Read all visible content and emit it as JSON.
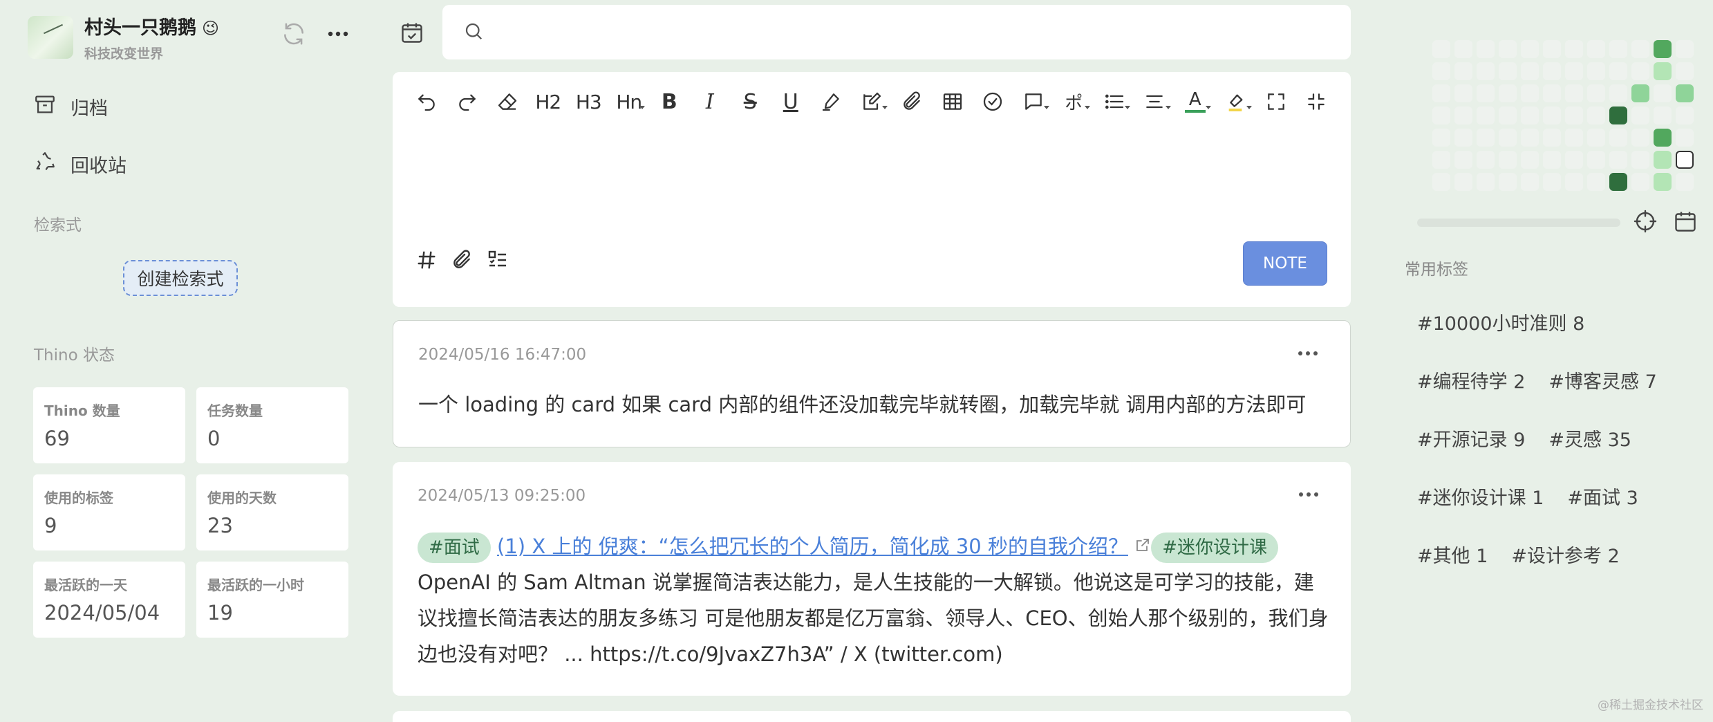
{
  "profile": {
    "name": "村头一只鹅鹅",
    "emoji": "😉",
    "subtitle": "科技改变世界"
  },
  "nav": {
    "archive": "归档",
    "recycle": "回收站"
  },
  "queries": {
    "title": "检索式",
    "create": "创建检索式"
  },
  "stats": {
    "title": "Thino 状态",
    "items": [
      {
        "label": "Thino 数量",
        "value": "69"
      },
      {
        "label": "任务数量",
        "value": "0"
      },
      {
        "label": "使用的标签",
        "value": "9"
      },
      {
        "label": "使用的天数",
        "value": "23"
      },
      {
        "label": "最活跃的一天",
        "value": "2024/05/04"
      },
      {
        "label": "最活跃的一小时",
        "value": "19"
      }
    ]
  },
  "search": {
    "placeholder": ""
  },
  "editor": {
    "toolbar": [
      "undo-icon",
      "redo-icon",
      "eraser-icon",
      "H2",
      "H3",
      "Hn",
      "bold-icon",
      "italic-icon",
      "strikethrough-icon",
      "underline-icon",
      "highlight-pen-icon",
      "edit-icon",
      "attachment-icon",
      "table-icon",
      "checkbox-icon",
      "comment-icon",
      "ruby-icon",
      "list-icon",
      "align-icon",
      "font-color-icon",
      "bg-color-icon",
      "fullscreen-icon",
      "compact-icon"
    ],
    "toolbar_text": {
      "h2": "H2",
      "h3": "H3",
      "hn": "Hn",
      "bold": "B",
      "italic": "I",
      "strike": "S",
      "underline": "U",
      "fontcolor": "A"
    },
    "submit": "NOTE",
    "accent": "#6a8fdf"
  },
  "memos": [
    {
      "date": "2024/05/16 16:47:00",
      "text": "一个 loading 的 card 如果 card 内部的组件还没加载完毕就转圈，加载完毕就 调用内部的方法即可"
    },
    {
      "date": "2024/05/13 09:25:00",
      "tag1": "#面试",
      "link": "(1) X 上的 倪爽：“怎么把冗长的个人简历，简化成 30 秒的自我介绍？",
      "tag2": "#迷你设计课",
      "body": "OpenAI 的 Sam Altman 说掌握简洁表达能力，是人生技能的一大解锁。他说这是可学习的技能，建议找擅长简洁表达的朋友多练习 可是他朋友都是亿万富翁、领导人、CEO、创始人那个级别的，我们身边也没有对吧？ ... https://t.co/9JvaxZ7h3A” / X (twitter.com)"
    }
  ],
  "heatmap": {
    "levels": [
      [
        0,
        0,
        0,
        0,
        0,
        0,
        0,
        0,
        0,
        0,
        3,
        0
      ],
      [
        0,
        0,
        0,
        0,
        0,
        0,
        0,
        0,
        0,
        0,
        1,
        0
      ],
      [
        0,
        0,
        0,
        0,
        0,
        0,
        0,
        0,
        0,
        2,
        0,
        2
      ],
      [
        0,
        0,
        0,
        0,
        0,
        0,
        0,
        0,
        4,
        0,
        0,
        0
      ],
      [
        0,
        0,
        0,
        0,
        0,
        0,
        0,
        0,
        0,
        0,
        3,
        0
      ],
      [
        0,
        0,
        0,
        0,
        0,
        0,
        0,
        0,
        0,
        0,
        1,
        5
      ],
      [
        0,
        0,
        0,
        0,
        0,
        0,
        0,
        0,
        4,
        0,
        1,
        0
      ]
    ],
    "colors": {
      "empty": "#eef2ee",
      "l1": "#b3e5b5",
      "l2": "#8fd499",
      "l3": "#52a85e",
      "l4": "#2f6e3d"
    }
  },
  "tags": {
    "title": "常用标签",
    "rows": [
      [
        "#10000小时准则 8"
      ],
      [
        "#编程待学 2",
        "#博客灵感 7"
      ],
      [
        "#开源记录 9",
        "#灵感 35"
      ],
      [
        "#迷你设计课 1",
        "#面试 3"
      ],
      [
        "#其他 1",
        "#设计参考 2"
      ]
    ]
  },
  "watermark": "@稀土掘金技术社区"
}
